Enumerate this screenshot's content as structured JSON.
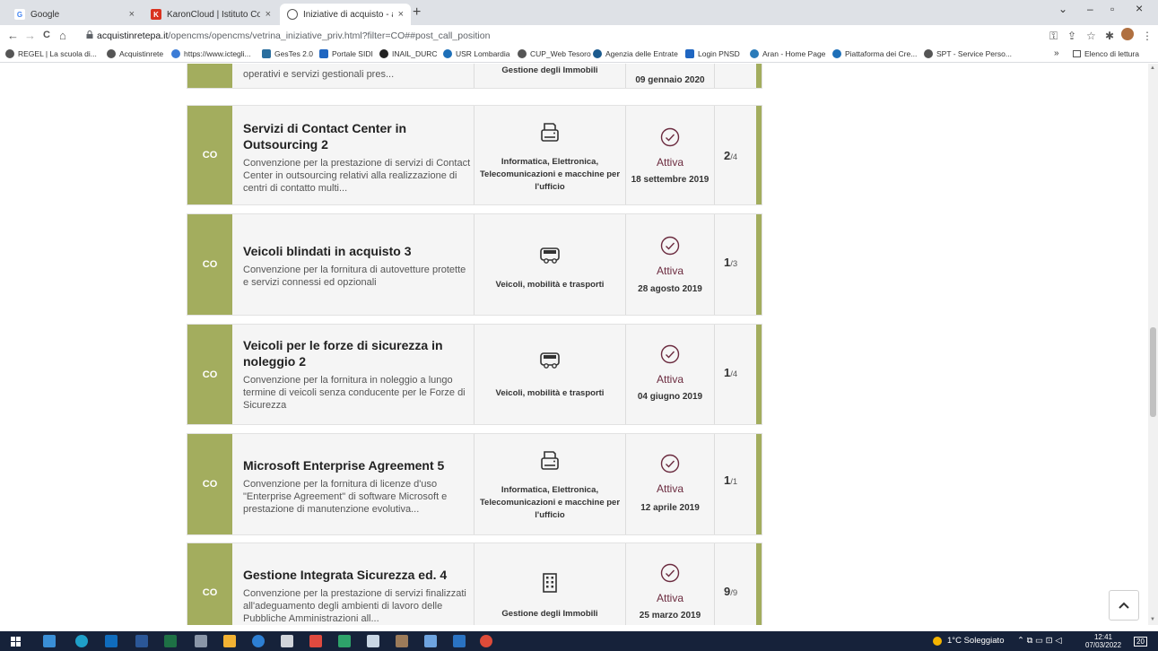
{
  "browser": {
    "tabs": [
      {
        "label": "Google",
        "close": "×",
        "active": false
      },
      {
        "label": "KaronCloud | Istituto Comprensi",
        "close": "×",
        "active": false
      },
      {
        "label": "Iniziative di acquisto - acquistinr",
        "close": "×",
        "active": true
      }
    ],
    "new_tab": "+",
    "window_controls": {
      "minimize": "–",
      "maximize": "▫",
      "close": "×",
      "dropdown": "⌄"
    },
    "nav": {
      "back": "←",
      "forward": "→",
      "reload": "C",
      "home": "⌂"
    },
    "url_host": "acquistinretepa.it",
    "url_path": "/opencms/opencms/vetrina_iniziative_priv.html?filter=CO##post_call_position",
    "bookmarks": [
      "REGEL | La scuola di...",
      "Acquistinrete",
      "https://www.ictegli...",
      "GesTes 2.0",
      "Portale SIDI",
      "INAIL_DURC",
      "USR Lombardia",
      "CUP_Web Tesoro",
      "Agenzia delle Entrate",
      "Login PNSD",
      "Aran - Home Page",
      "Piattaforma dei Cre...",
      "SPT - Service Perso..."
    ],
    "bookmarks_more": "»",
    "reading_list": "Elenco di lettura"
  },
  "partial_card": {
    "desc": "operativi e servizi gestionali pres...",
    "category": "Gestione degli Immobili",
    "date": "09 gennaio 2020"
  },
  "cards": [
    {
      "tag": "CO",
      "title": "Servizi di Contact Center in Outsourcing 2",
      "desc": "Convenzione per la prestazione di servizi di Contact Center in outsourcing relativi alla realizzazione di centri di contatto multi...",
      "category": "Informatica, Elettronica, Telecomunicazioni e macchine per l'ufficio",
      "icon": "printer-icon",
      "status": "Attiva",
      "date": "18 settembre 2019",
      "count_main": "2",
      "count_total": "/4"
    },
    {
      "tag": "CO",
      "title": "Veicoli blindati in acquisto 3",
      "desc": "Convenzione per la fornitura di autovetture protette e servizi connessi ed opzionali",
      "category": "Veicoli, mobilità e trasporti",
      "icon": "vehicle-icon",
      "status": "Attiva",
      "date": "28 agosto 2019",
      "count_main": "1",
      "count_total": "/3"
    },
    {
      "tag": "CO",
      "title": "Veicoli per le forze di sicurezza in noleggio 2",
      "desc": "Convenzione per la fornitura in noleggio a lungo termine di veicoli senza conducente per le Forze di Sicurezza",
      "category": "Veicoli, mobilità e trasporti",
      "icon": "vehicle-icon",
      "status": "Attiva",
      "date": "04 giugno 2019",
      "count_main": "1",
      "count_total": "/4"
    },
    {
      "tag": "CO",
      "title": "Microsoft Enterprise Agreement 5",
      "desc": "Convenzione per la fornitura di licenze d'uso \"Enterprise Agreement\" di software Microsoft e prestazione di manutenzione evolutiva...",
      "category": "Informatica, Elettronica, Telecomunicazioni e macchine per l'ufficio",
      "icon": "printer-icon",
      "status": "Attiva",
      "date": "12 aprile 2019",
      "count_main": "1",
      "count_total": "/1"
    },
    {
      "tag": "CO",
      "title": "Gestione Integrata Sicurezza ed. 4",
      "desc": "Convenzione per la prestazione di servizi finalizzati all'adeguamento degli ambienti di lavoro delle Pubbliche Amministrazioni all...",
      "category": "Gestione degli Immobili",
      "icon": "building-icon",
      "status": "Attiva",
      "date": "25 marzo 2019",
      "count_main": "9",
      "count_total": "/9"
    }
  ],
  "taskbar": {
    "weather": "1°C Soleggiato",
    "time": "12:41",
    "date": "07/03/2022",
    "notifications": "20"
  },
  "colors": {
    "accent_green": "#a3ad5e",
    "status_wine": "#6b2b3f"
  }
}
